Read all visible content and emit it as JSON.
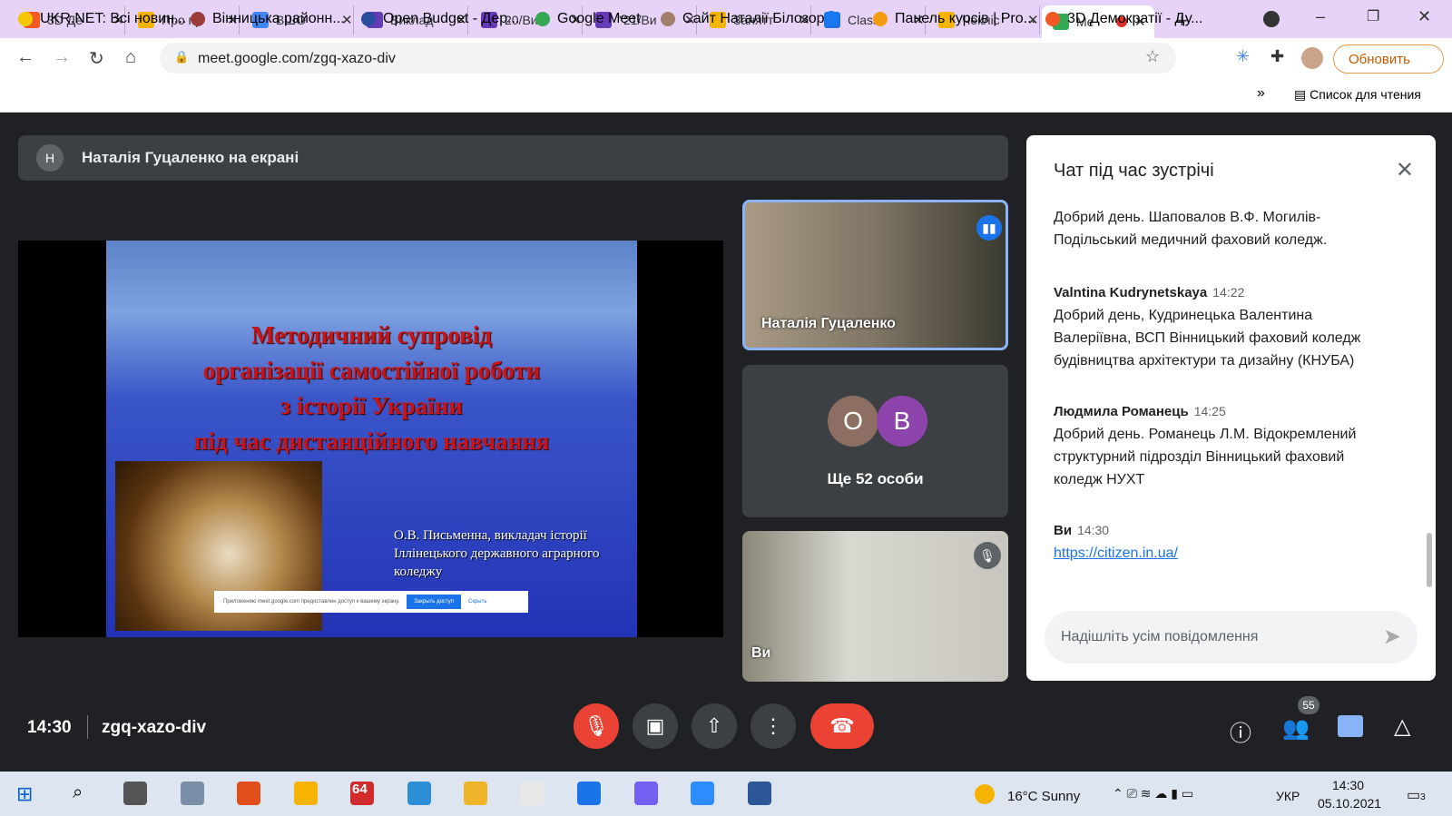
{
  "tabs": [
    "3D Де",
    "Про пр",
    "ВШО",
    "Виклад",
    "20/Вик",
    "\"21/Ви",
    "Занятт",
    "Classti",
    "Чекліс",
    "Me"
  ],
  "tab_colors": [
    "#f15a24",
    "#f4b400",
    "#4285f4",
    "#673ab7",
    "#673ab7",
    "#673ab7",
    "#f4b400",
    "#1a73e8",
    "#f4b400",
    "#34a853"
  ],
  "url": "meet.google.com/zgq-xazo-div",
  "update_label": "Обновить",
  "bookmarks": [
    "UKR.NET: Всі новин...",
    "Вінницька районн...",
    "Open Budget - Дер...",
    "Google Meet",
    "Сайт Наталії Білозор",
    "",
    "Панель курсів | Pro...",
    "3D Демократії - Ду..."
  ],
  "bookmark_more": "»",
  "reading_list": "Список для чтения",
  "presenter": {
    "avatar": "Н",
    "label": "Наталія Гуцаленко на екрані"
  },
  "slide": {
    "title": [
      "Методичний супровід",
      "організації самостійної роботи",
      "з історії України",
      "під час дистанційного навчання"
    ],
    "author": "О.В. Письменна, викладач історії Іллінецького державного аграрного коледжу",
    "share_msg": "Приложению meet.google.com предоставлен доступ к вашему экрану.",
    "share_stop": "Закрыть доступ",
    "share_hide": "Скрыть"
  },
  "tiles": {
    "speaker": "Наталія Гуцаленко",
    "others_avatars": [
      "О",
      "В"
    ],
    "others_label": "Ще 52 особи",
    "self": "Ви"
  },
  "chat": {
    "title": "Чат під час зустрічі",
    "messages": [
      {
        "sender": "",
        "time": "",
        "text": "Добрий день. Шаповалов В.Ф. Могилів-Подільський медичний фаховий коледж."
      },
      {
        "sender": "Valntina Kudrynetskaya",
        "time": "14:22",
        "text": "Добрий день, Кудринецька Валентина Валеріївна, ВСП Вінницький фаховий коледж будівництва архітектури та дизайну (КНУБА)"
      },
      {
        "sender": "Людмила Романець",
        "time": "14:25",
        "text": "Добрий день. Романець Л.М. Відокремлений структурний підрозділ Вінницький фаховий коледж НУХТ"
      },
      {
        "sender": "Ви",
        "time": "14:30",
        "text": "https://citizen.in.ua/"
      }
    ],
    "placeholder": "Надішліть усім повідомлення"
  },
  "meeting": {
    "time": "14:30",
    "code": "zgq-xazo-div",
    "participants": "55"
  },
  "taskbar": {
    "weather": "16°C  Sunny",
    "lang": "УКР",
    "time": "14:30",
    "date": "05.10.2021",
    "notif": "3",
    "app64": "64"
  }
}
